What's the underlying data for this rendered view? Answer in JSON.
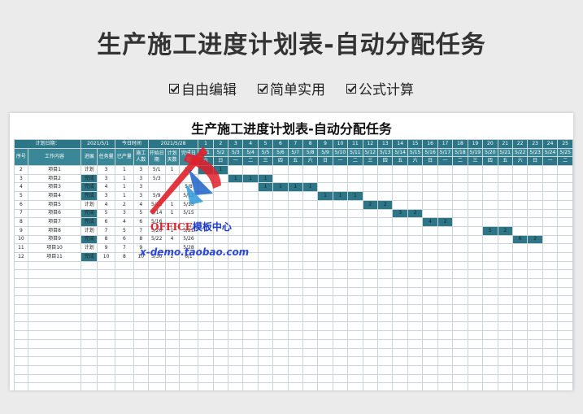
{
  "banner": {
    "title": "生产施工进度计划表-自动分配任务",
    "features": [
      "自由编辑",
      "简单实用",
      "公式计算"
    ]
  },
  "sheet": {
    "title": "生产施工进度计划表-自动分配任务",
    "plan_date_label": "计划日期：",
    "plan_date": "2021/5/1",
    "today_label": "今日时间",
    "today": "2021/5/28",
    "columns": [
      "序号",
      "工作内容",
      "进展",
      "任务量",
      "已产量",
      "施工人数",
      "开始日期",
      "计划天数",
      "完成日期"
    ],
    "days": [
      "1",
      "2",
      "3",
      "4",
      "5",
      "6",
      "7",
      "8",
      "9",
      "10",
      "11",
      "12",
      "13",
      "14",
      "15",
      "16",
      "17",
      "18",
      "19",
      "20",
      "21",
      "22",
      "23",
      "24",
      "25"
    ],
    "dates": [
      "5/1",
      "5/2",
      "5/3",
      "5/4",
      "5/5",
      "5/6",
      "5/7",
      "5/8",
      "5/9",
      "5/10",
      "5/11",
      "5/12",
      "5/13",
      "5/14",
      "5/15",
      "5/16",
      "5/17",
      "5/18",
      "5/19",
      "5/20",
      "5/21",
      "5/22",
      "5/23",
      "5/24",
      "5/25"
    ],
    "weekdays": [
      "六",
      "日",
      "一",
      "二",
      "三",
      "四",
      "五",
      "六",
      "日",
      "一",
      "二",
      "三",
      "四",
      "五",
      "六",
      "日",
      "一",
      "二",
      "三",
      "四",
      "五",
      "六",
      "日",
      "一",
      "二"
    ],
    "rows": [
      {
        "no": "2",
        "name": "项目1",
        "status": "计划",
        "qty": "3",
        "done": "1",
        "workers": "3",
        "start": "5/1",
        "days": "1",
        "end": "5/1",
        "gantt": {
          "1": "1",
          "2": "1"
        }
      },
      {
        "no": "3",
        "name": "项目2",
        "status": "完成",
        "qty": "3",
        "done": "1",
        "workers": "3",
        "start": "5/3",
        "days": "",
        "end": "",
        "gantt": {
          "3": "1",
          "4": "1",
          "5": "1"
        }
      },
      {
        "no": "4",
        "name": "项目3",
        "status": "完成",
        "qty": "4",
        "done": "1",
        "workers": "3",
        "start": "",
        "days": "",
        "end": "5/8",
        "gantt": {
          "5": "1",
          "6": "1",
          "7": "1",
          "8": "1"
        }
      },
      {
        "no": "5",
        "name": "项目4",
        "status": "完成",
        "qty": "3",
        "done": "1",
        "workers": "3",
        "start": "5/9",
        "days": "",
        "end": "5/11",
        "gantt": {
          "9": "1",
          "10": "1",
          "11": "1"
        }
      },
      {
        "no": "6",
        "name": "项目5",
        "status": "计划",
        "qty": "4",
        "done": "2",
        "workers": "4",
        "start": "5/12",
        "days": "1",
        "end": "5/13",
        "gantt": {
          "12": "2",
          "13": "2"
        }
      },
      {
        "no": "7",
        "name": "项目6",
        "status": "完成",
        "qty": "5",
        "done": "3",
        "workers": "5",
        "start": "5/14",
        "days": "1",
        "end": "5/15",
        "gantt": {
          "14": "3",
          "15": "2"
        }
      },
      {
        "no": "8",
        "name": "项目7",
        "status": "完成",
        "qty": "6",
        "done": "4",
        "workers": "6",
        "start": "5/16",
        "days": "",
        "end": "",
        "gantt": {
          "16": "4",
          "17": "2"
        }
      },
      {
        "no": "9",
        "name": "项目8",
        "status": "计划",
        "qty": "7",
        "done": "5",
        "workers": "7",
        "start": "5/20",
        "days": "1",
        "end": "5/21",
        "gantt": {
          "20": "5",
          "21": "2"
        }
      },
      {
        "no": "10",
        "name": "项目9",
        "status": "完成",
        "qty": "8",
        "done": "6",
        "workers": "8",
        "start": "5/22",
        "days": "4",
        "end": "5/26",
        "gantt": {
          "22": "6",
          "23": "2"
        }
      },
      {
        "no": "11",
        "name": "项目10",
        "status": "计划",
        "qty": "9",
        "done": "7",
        "workers": "9",
        "start": "",
        "days": "",
        "end": "5/28",
        "gantt": {}
      },
      {
        "no": "12",
        "name": "项目11",
        "status": "完成",
        "qty": "10",
        "done": "8",
        "workers": "10",
        "start": "5/30",
        "days": "2",
        "end": "6/1",
        "gantt": {}
      }
    ],
    "empty_rows": 16
  },
  "watermark": {
    "brand_red": "OFFICE",
    "brand_blue": "模板中心",
    "url": "x-demo.taobao.com"
  },
  "colors": {
    "header": "#2c7687",
    "grid_line": "#c8d4d6",
    "background": "#ebebeb"
  }
}
